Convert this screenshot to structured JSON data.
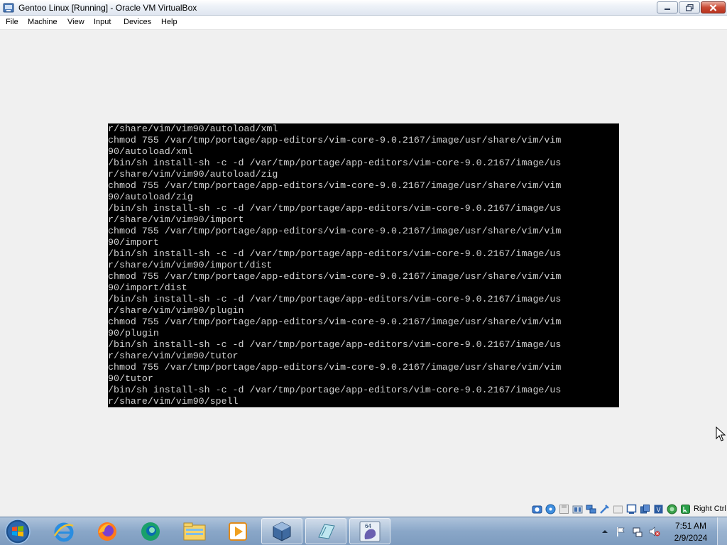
{
  "window": {
    "title": "Gentoo Linux [Running] - Oracle VM VirtualBox",
    "icon": "virtualbox-app-icon"
  },
  "menubar": {
    "items": [
      "File",
      "Machine",
      "View",
      "Input",
      "Devices",
      "Help"
    ]
  },
  "console": {
    "lines": [
      "r/share/vim/vim90/autoload/xml",
      "chmod 755 /var/tmp/portage/app-editors/vim-core-9.0.2167/image/usr/share/vim/vim",
      "90/autoload/xml",
      "/bin/sh install-sh -c -d /var/tmp/portage/app-editors/vim-core-9.0.2167/image/us",
      "r/share/vim/vim90/autoload/zig",
      "chmod 755 /var/tmp/portage/app-editors/vim-core-9.0.2167/image/usr/share/vim/vim",
      "90/autoload/zig",
      "/bin/sh install-sh -c -d /var/tmp/portage/app-editors/vim-core-9.0.2167/image/us",
      "r/share/vim/vim90/import",
      "chmod 755 /var/tmp/portage/app-editors/vim-core-9.0.2167/image/usr/share/vim/vim",
      "90/import",
      "/bin/sh install-sh -c -d /var/tmp/portage/app-editors/vim-core-9.0.2167/image/us",
      "r/share/vim/vim90/import/dist",
      "chmod 755 /var/tmp/portage/app-editors/vim-core-9.0.2167/image/usr/share/vim/vim",
      "90/import/dist",
      "/bin/sh install-sh -c -d /var/tmp/portage/app-editors/vim-core-9.0.2167/image/us",
      "r/share/vim/vim90/plugin",
      "chmod 755 /var/tmp/portage/app-editors/vim-core-9.0.2167/image/usr/share/vim/vim",
      "90/plugin",
      "/bin/sh install-sh -c -d /var/tmp/portage/app-editors/vim-core-9.0.2167/image/us",
      "r/share/vim/vim90/tutor",
      "chmod 755 /var/tmp/portage/app-editors/vim-core-9.0.2167/image/usr/share/vim/vim",
      "90/tutor",
      "/bin/sh install-sh -c -d /var/tmp/portage/app-editors/vim-core-9.0.2167/image/us",
      "r/share/vim/vim90/spell"
    ]
  },
  "statusbar": {
    "icons": [
      "hard-disk-icon",
      "optical-drive-icon",
      "floppy-drive-icon",
      "audio-icon",
      "network-icon",
      "usb-icon",
      "shared-folders-icon",
      "display-icon",
      "recording-icon",
      "cpu-icon",
      "vt-x-icon",
      "mouse-integration-icon",
      "keyboard-capture-icon"
    ],
    "host_key": "Right Ctrl"
  },
  "taskbar": {
    "items": [
      "internet-explorer-icon",
      "firefox-icon",
      "edge-icon",
      "file-explorer-icon",
      "media-player-icon",
      "virtualbox-manager-icon",
      "notepad-icon",
      "virtualbox-vm-icon"
    ],
    "tray": [
      "show-hidden-icons-icon",
      "action-center-flag-icon",
      "network-tray-icon",
      "volume-muted-icon"
    ],
    "clock": {
      "time": "7:51 AM",
      "date": "2/9/2024"
    }
  },
  "colors": {
    "console_bg": "#000000",
    "console_fg": "#d0d0d0",
    "window_bg": "#f0f0f0",
    "taskbar": "#8aa7c8"
  }
}
